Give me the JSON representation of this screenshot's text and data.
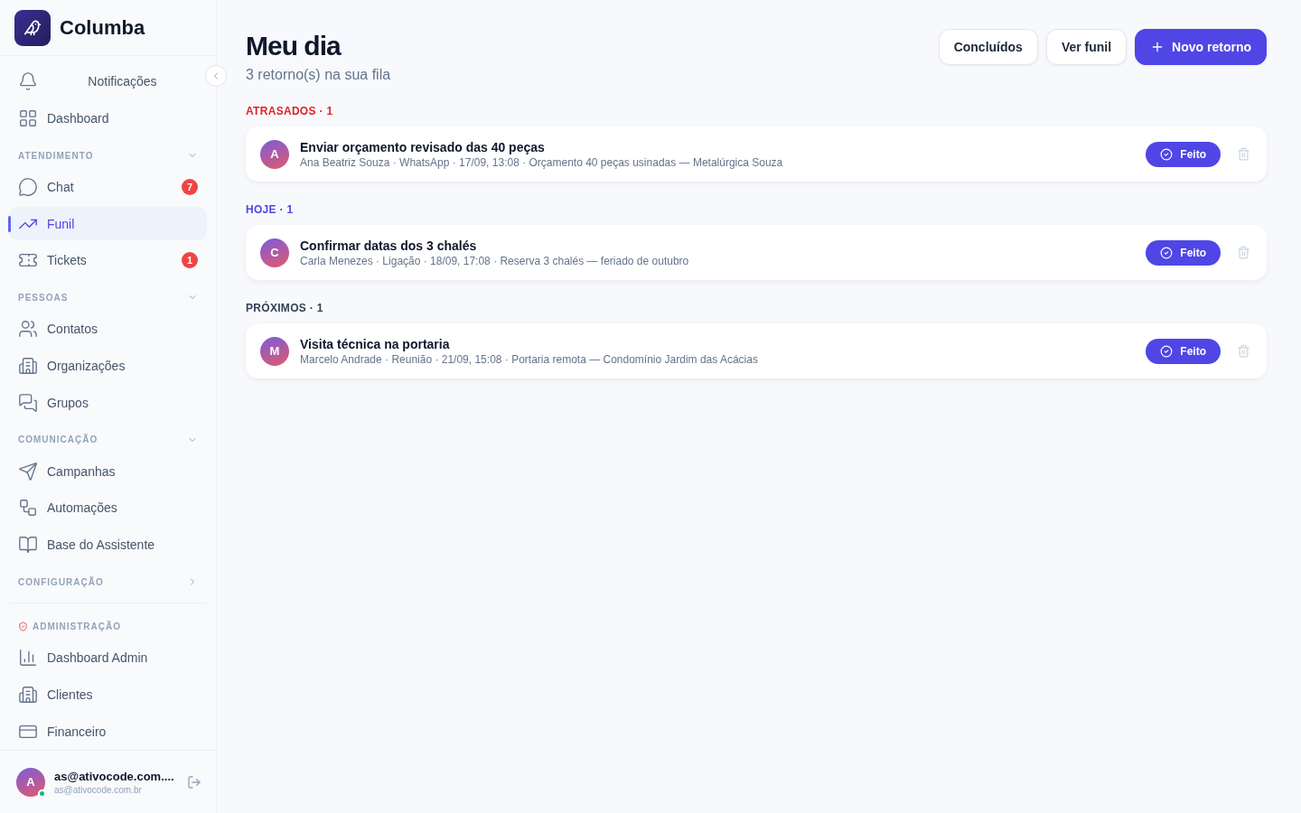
{
  "brand": {
    "name": "Columba"
  },
  "sidebar": {
    "top_items": [
      {
        "label": "Notificações",
        "selected": false
      },
      {
        "label": "Dashboard",
        "selected": false
      }
    ],
    "sections": [
      {
        "title": "ATENDIMENTO",
        "kind": "group",
        "expanded": true,
        "items": [
          {
            "label": "Chat",
            "selected": false,
            "badge": "7"
          },
          {
            "label": "Funil",
            "selected": true
          },
          {
            "label": "Tickets",
            "selected": false,
            "badge": "1"
          }
        ]
      },
      {
        "title": "PESSOAS",
        "kind": "group",
        "expanded": true,
        "items": [
          {
            "label": "Contatos",
            "selected": false
          },
          {
            "label": "Organizações",
            "selected": false
          },
          {
            "label": "Grupos",
            "selected": false
          }
        ]
      },
      {
        "title": "COMUNICAÇÃO",
        "kind": "group",
        "expanded": true,
        "items": [
          {
            "label": "Campanhas",
            "selected": false
          },
          {
            "label": "Automações",
            "selected": false
          },
          {
            "label": "Base do Assistente",
            "selected": false
          }
        ]
      },
      {
        "title": "CONFIGURAÇÃO",
        "kind": "group",
        "expanded": false
      },
      {
        "title": "ADMINISTRAÇÃO",
        "kind": "admin",
        "items": [
          {
            "label": "Dashboard Admin",
            "selected": false
          },
          {
            "label": "Clientes",
            "selected": false
          },
          {
            "label": "Financeiro",
            "selected": false
          }
        ]
      }
    ],
    "user": {
      "initial": "A",
      "name": "as@ativocode.com....",
      "email": "as@ativocode.com.br",
      "online": true
    }
  },
  "page": {
    "title": "Meu dia",
    "subtitle": "3 retorno(s) na sua fila",
    "buttons": [
      {
        "label": "Concluídos",
        "kind": "secondary"
      },
      {
        "label": "Ver funil",
        "kind": "secondary"
      },
      {
        "label": "Novo retorno",
        "kind": "primary"
      }
    ]
  },
  "groups": [
    {
      "title": "ATRASADOS · 1",
      "color": "#dc2626",
      "tasks": [
        {
          "initial": "A",
          "title": "Enviar orçamento revisado das 40 peças",
          "meta": "Ana Beatriz Souza · WhatsApp · 17/09, 13:08 · Orçamento 40 peças usinadas — Metalúrgica Souza",
          "action": "Feito"
        }
      ]
    },
    {
      "title": "HOJE · 1",
      "color": "#4f46e5",
      "tasks": [
        {
          "initial": "C",
          "title": "Confirmar datas dos 3 chalés",
          "meta": "Carla Menezes · Ligação · 18/09, 17:08 · Reserva 3 chalés — feriado de outubro",
          "action": "Feito"
        }
      ]
    },
    {
      "title": "PRÓXIMOS · 1",
      "color": "#334155",
      "tasks": [
        {
          "initial": "M",
          "title": "Visita técnica na portaria",
          "meta": "Marcelo Andrade · Reunião · 21/09, 15:08 · Portaria remota — Condomínio Jardim das Acácias",
          "action": "Feito"
        }
      ]
    }
  ]
}
